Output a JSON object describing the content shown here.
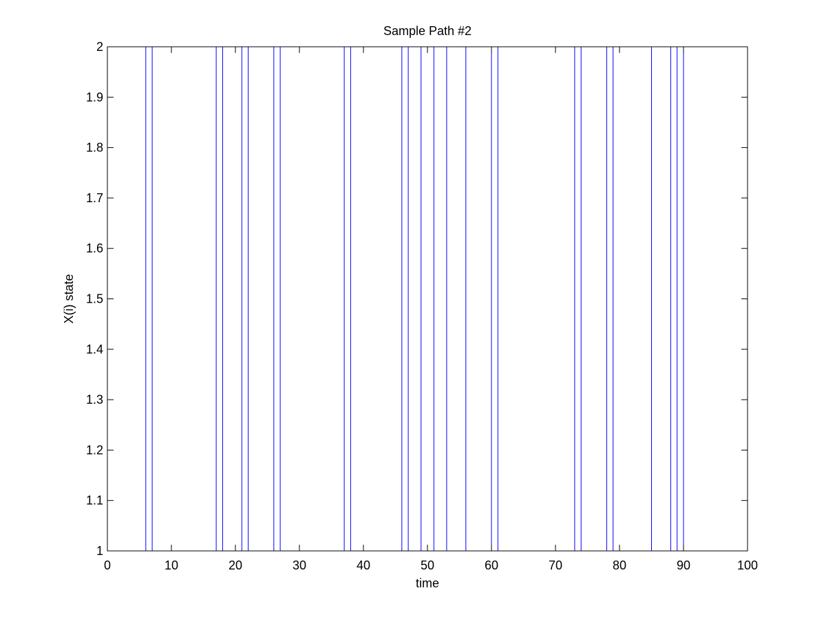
{
  "chart_data": {
    "type": "line",
    "title": "Sample Path #2",
    "xlabel": "time",
    "ylabel": "X(i) state",
    "xlim": [
      0,
      100
    ],
    "ylim": [
      1,
      2
    ],
    "xticks": [
      0,
      10,
      20,
      30,
      40,
      50,
      60,
      70,
      80,
      90,
      100
    ],
    "xtick_labels": [
      "0",
      "10",
      "20",
      "30",
      "40",
      "50",
      "60",
      "70",
      "80",
      "90",
      "100"
    ],
    "yticks": [
      1,
      1.1,
      1.2,
      1.3,
      1.4,
      1.5,
      1.6,
      1.7,
      1.8,
      1.9,
      2
    ],
    "ytick_labels": [
      "1",
      "1.1",
      "1.2",
      "1.3",
      "1.4",
      "1.5",
      "1.6",
      "1.7",
      "1.8",
      "1.9",
      "2"
    ],
    "grid": false,
    "legend": "none",
    "series": [
      {
        "color": "#0000ff",
        "x": [
          0,
          6,
          6,
          7,
          7,
          17,
          17,
          18,
          18,
          21,
          21,
          22,
          22,
          26,
          26,
          27,
          27,
          37,
          37,
          38,
          38,
          46,
          46,
          47,
          47,
          49,
          49,
          51,
          51,
          53,
          53,
          56,
          56,
          60,
          60,
          61,
          61,
          73,
          73,
          74,
          74,
          78,
          78,
          79,
          79,
          85,
          85,
          88,
          88,
          89,
          89,
          90,
          90,
          100
        ],
        "y": [
          1,
          1,
          2,
          2,
          1,
          1,
          2,
          2,
          1,
          1,
          2,
          2,
          1,
          1,
          2,
          2,
          1,
          1,
          2,
          2,
          1,
          1,
          2,
          2,
          1,
          1,
          2,
          2,
          1,
          1,
          2,
          2,
          1,
          1,
          2,
          2,
          1,
          1,
          2,
          2,
          1,
          1,
          2,
          2,
          1,
          1,
          2,
          2,
          1,
          1,
          2,
          2,
          1,
          1
        ]
      }
    ]
  }
}
